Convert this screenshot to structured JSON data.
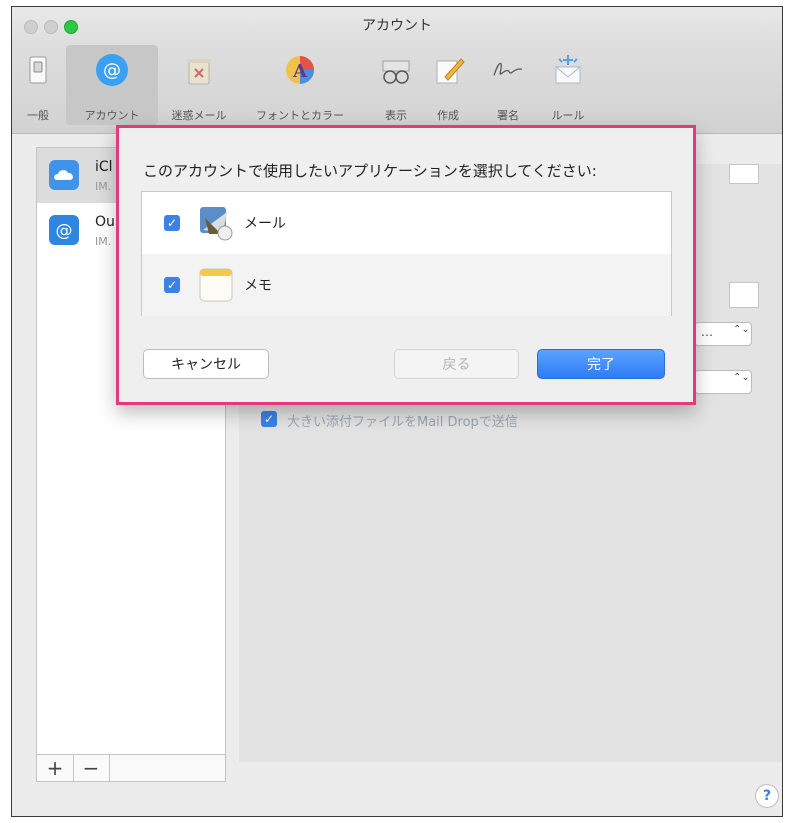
{
  "window": {
    "title": "アカウント"
  },
  "toolbar": {
    "items": [
      {
        "label": "一般",
        "icon": "switch-icon"
      },
      {
        "label": "アカウント",
        "icon": "at-sign-icon"
      },
      {
        "label": "迷惑メール",
        "icon": "junk-trash-icon"
      },
      {
        "label": "フォントとカラー",
        "icon": "font-color-icon"
      },
      {
        "label": "表示",
        "icon": "glasses-icon"
      },
      {
        "label": "作成",
        "icon": "pencil-icon"
      },
      {
        "label": "署名",
        "icon": "signature-icon"
      },
      {
        "label": "ルール",
        "icon": "rules-envelope-icon"
      }
    ],
    "active_index": 1
  },
  "sidebar": {
    "accounts": [
      {
        "name": "iCl",
        "type": "IM.",
        "icon": "icloud-icon"
      },
      {
        "name": "Ou",
        "type": "IM.",
        "icon": "at-sign-icon"
      }
    ],
    "add_label": "+",
    "remove_label": "−"
  },
  "background": {
    "checkbox_text": "大きい添付ファイルをMail Dropで送信",
    "popup1_text": "…",
    "popup_arrow": "⌃⌄"
  },
  "sheet": {
    "prompt": "このアカウントで使用したいアプリケーションを選択してください:",
    "apps": [
      {
        "name": "メール",
        "checked": true,
        "icon": "mail-app-icon"
      },
      {
        "name": "メモ",
        "checked": true,
        "icon": "notes-app-icon"
      }
    ],
    "cancel_label": "キャンセル",
    "back_label": "戻る",
    "done_label": "完了"
  },
  "help_label": "?",
  "colors": {
    "accent": "#3b82e6",
    "highlight_border": "#e23b7d",
    "green_light": "#2ac845"
  }
}
